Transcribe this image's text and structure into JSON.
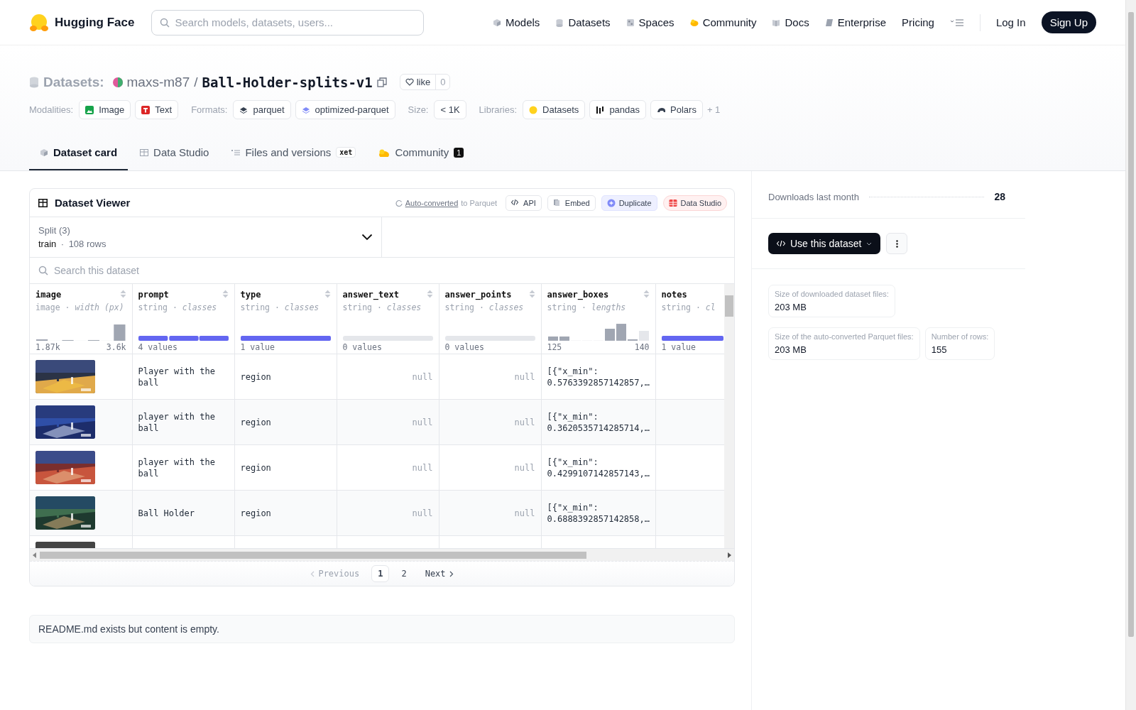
{
  "header": {
    "brand": "Hugging Face",
    "search": {
      "placeholder": "Search models, datasets, users..."
    },
    "nav": [
      {
        "label": "Models"
      },
      {
        "label": "Datasets"
      },
      {
        "label": "Spaces"
      },
      {
        "label": "Community"
      },
      {
        "label": "Docs"
      },
      {
        "label": "Enterprise"
      },
      {
        "label": "Pricing"
      }
    ],
    "login": "Log In",
    "signup": "Sign Up"
  },
  "repo": {
    "section": "Datasets:",
    "owner": "maxs-m87",
    "separator": "/",
    "name": "Ball-Holder-splits-v1",
    "like": {
      "label": "like",
      "count": "0"
    },
    "tag_groups": [
      {
        "label": "Modalities:",
        "items": [
          "Image",
          "Text"
        ]
      },
      {
        "label": "Formats:",
        "items": [
          "parquet",
          "optimized-parquet"
        ]
      },
      {
        "label": "Size:",
        "items": [
          "< 1K"
        ]
      },
      {
        "label": "Libraries:",
        "items": [
          "Datasets",
          "pandas",
          "Polars"
        ],
        "more": "+ 1"
      }
    ],
    "tabs": [
      {
        "label": "Dataset card",
        "selected": true
      },
      {
        "label": "Data Studio",
        "selected": false
      },
      {
        "label": "Files and versions",
        "selected": false,
        "badge": "xet"
      },
      {
        "label": "Community",
        "selected": false,
        "count": "1"
      }
    ]
  },
  "viewer": {
    "title": "Dataset Viewer",
    "auto_converted": "Auto-converted",
    "auto_converted_suffix": "to Parquet",
    "actions": [
      "API",
      "Embed",
      "Duplicate",
      "Data Studio"
    ],
    "split": {
      "label": "Split (3)",
      "value": "train",
      "separator": "·",
      "rows": "108 rows"
    },
    "search": {
      "placeholder": "Search this dataset"
    },
    "columns": [
      {
        "name": "image",
        "type": "image · *width (px)*",
        "kind": "histogram",
        "min": "1.87k",
        "max": "3.6k"
      },
      {
        "name": "prompt",
        "type": "string · *classes*",
        "kind": "classes",
        "summary": "4 values"
      },
      {
        "name": "type",
        "type": "string · *classes*",
        "kind": "classes",
        "summary": "1 value"
      },
      {
        "name": "answer_text",
        "type": "string · *classes*",
        "kind": "empty",
        "summary": "0 values"
      },
      {
        "name": "answer_points",
        "type": "string · *classes*",
        "kind": "empty",
        "summary": "0 values"
      },
      {
        "name": "answer_boxes",
        "type": "string · *lengths*",
        "kind": "histogram",
        "min": "125",
        "max": "140"
      },
      {
        "name": "notes",
        "type": "string · *cl*",
        "kind": "classes",
        "summary": "1 value"
      }
    ],
    "rows": [
      {
        "image": {
          "kind": "picture"
        },
        "prompt": "Player with the ball",
        "type": "region",
        "answer_text": "null",
        "answer_points": "null",
        "answer_boxes": "[{\"x_min\": 0.5763392857142857,…"
      },
      {
        "image": {
          "kind": "picture"
        },
        "prompt": "player with the ball",
        "type": "region",
        "answer_text": "null",
        "answer_points": "null",
        "answer_boxes": "[{\"x_min\": 0.3620535714285714,…"
      },
      {
        "image": {
          "kind": "picture"
        },
        "prompt": "player with the ball",
        "type": "region",
        "answer_text": "null",
        "answer_points": "null",
        "answer_boxes": "[{\"x_min\": 0.4299107142857143,…"
      },
      {
        "image": {
          "kind": "picture"
        },
        "prompt": "Ball Holder",
        "type": "region",
        "answer_text": "null",
        "answer_points": "null",
        "answer_boxes": "[{\"x_min\": 0.6888392857142858,…"
      },
      {
        "image": {
          "kind": "picture"
        }
      }
    ],
    "pagination": [
      {
        "label": "Previous",
        "kind": "prev",
        "disabled": true
      },
      {
        "label": "1",
        "kind": "page",
        "selected": true
      },
      {
        "label": "2",
        "kind": "page",
        "selected": false
      },
      {
        "label": "Next",
        "kind": "next",
        "disabled": false
      }
    ]
  },
  "readme": "README.md exists but content is empty.",
  "sidebar": {
    "downloads": {
      "label": "Downloads last month",
      "value": "28"
    },
    "use_button": "Use this dataset",
    "stats": [
      {
        "label": "Size of downloaded dataset files:",
        "value": "203 MB"
      },
      {
        "label": "Size of the auto-converted Parquet files:",
        "value": "203 MB"
      },
      {
        "label": "Number of rows:",
        "value": "155"
      }
    ]
  }
}
